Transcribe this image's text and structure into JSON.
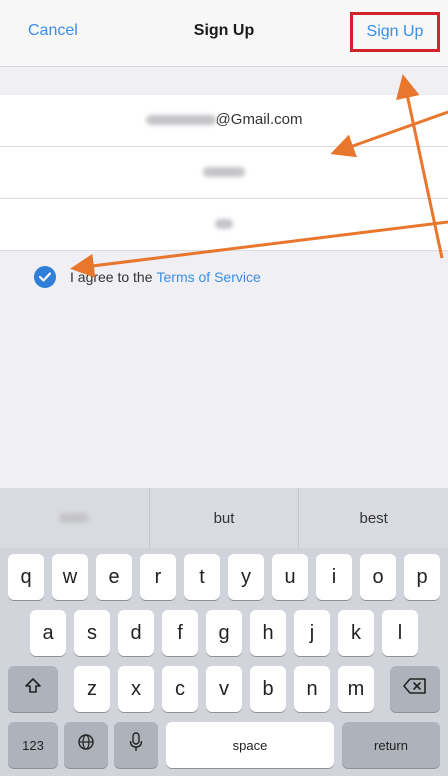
{
  "nav": {
    "cancel_label": "Cancel",
    "title": "Sign Up",
    "signup_label": "Sign Up"
  },
  "form": {
    "email_suffix": "@Gmail.com"
  },
  "agreement": {
    "prefix": "I agree to the",
    "link": "Terms of Service"
  },
  "keyboard": {
    "suggestions": [
      "but",
      "best"
    ],
    "row1": [
      "q",
      "w",
      "e",
      "r",
      "t",
      "y",
      "u",
      "i",
      "o",
      "p"
    ],
    "row2": [
      "a",
      "s",
      "d",
      "f",
      "g",
      "h",
      "j",
      "k",
      "l"
    ],
    "row3": [
      "z",
      "x",
      "c",
      "v",
      "b",
      "n",
      "m"
    ],
    "numbers_label": "123",
    "space_label": "space",
    "return_label": "return",
    "icons": [
      "shift-icon",
      "delete-icon",
      "globe-icon",
      "microphone-icon"
    ]
  },
  "colors": {
    "accent": "#3b8ee6",
    "highlight_box": "#d4222a",
    "annotation_arrow": "#e8762c"
  }
}
